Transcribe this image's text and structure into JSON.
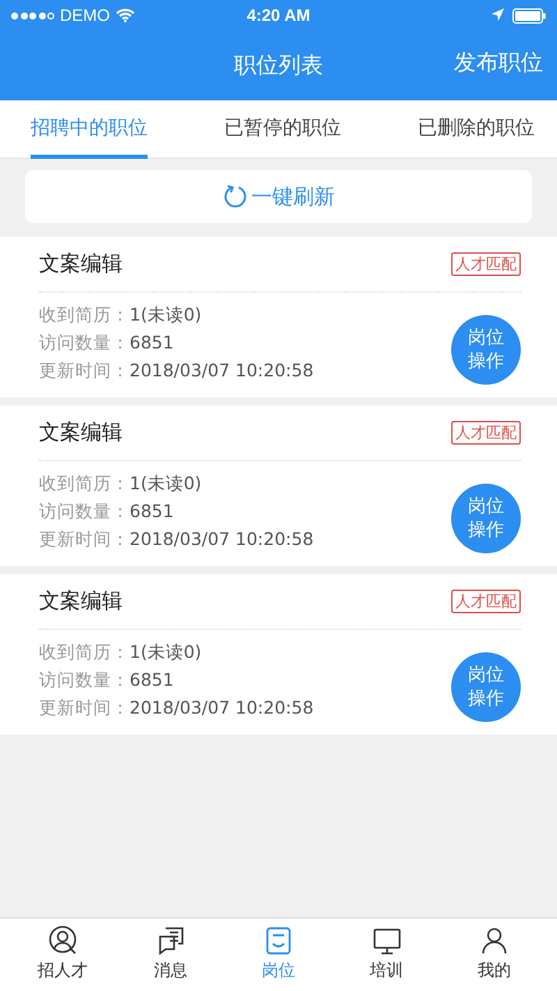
{
  "status_bar": {
    "carrier": "DEMO",
    "time": "4:20 AM"
  },
  "nav": {
    "title": "职位列表",
    "action": "发布职位"
  },
  "tabs": [
    {
      "label": "招聘中的职位",
      "selected": true
    },
    {
      "label": "已暂停的职位",
      "selected": false
    },
    {
      "label": "已删除的职位",
      "selected": false
    }
  ],
  "refresh_button": "一键刷新",
  "jobs": [
    {
      "title": "文案编辑",
      "tag": "人才匹配",
      "fields": [
        {
          "label": "收到简历：",
          "value": "1(未读0)"
        },
        {
          "label": "访问数量：",
          "value": "6851"
        },
        {
          "label": "更新时间：",
          "value": "2018/03/07 10:20:58"
        }
      ],
      "action": "岗位操作"
    },
    {
      "title": "文案编辑",
      "tag": "人才匹配",
      "fields": [
        {
          "label": "收到简历：",
          "value": "1(未读0)"
        },
        {
          "label": "访问数量：",
          "value": "6851"
        },
        {
          "label": "更新时间：",
          "value": "2018/03/07 10:20:58"
        }
      ],
      "action": "岗位操作"
    },
    {
      "title": "文案编辑",
      "tag": "人才匹配",
      "fields": [
        {
          "label": "收到简历：",
          "value": "1(未读0)"
        },
        {
          "label": "访问数量：",
          "value": "6851"
        },
        {
          "label": "更新时间：",
          "value": "2018/03/07 10:20:58"
        }
      ],
      "action": "岗位操作"
    }
  ],
  "tab_bar": [
    {
      "label": "招人才",
      "kind": "person",
      "selected": false
    },
    {
      "label": "消息",
      "kind": "chat",
      "selected": false
    },
    {
      "label": "岗位",
      "kind": "post",
      "selected": true
    },
    {
      "label": "培训",
      "kind": "screen",
      "selected": false
    },
    {
      "label": "我的",
      "kind": "me",
      "selected": false
    }
  ]
}
